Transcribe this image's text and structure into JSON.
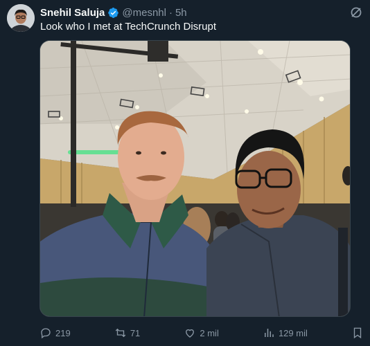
{
  "tweet": {
    "author_name": "Snehil Saluja",
    "handle": "@mesnhl",
    "separator": "·",
    "time": "5h",
    "text": "Look who I met at TechCrunch Disrupt",
    "verified": true,
    "accent_color": "#1d9bf0"
  },
  "actions": {
    "replies": "219",
    "reposts": "71",
    "likes": "2 mil",
    "views": "129 mil"
  },
  "icons": {
    "grok": "grok-icon",
    "reply": "reply-icon",
    "repost": "repost-icon",
    "like": "heart-icon",
    "views": "views-icon",
    "bookmark": "bookmark-icon"
  },
  "theme": {
    "background": "#15202b",
    "text_primary": "#f7f9f9",
    "text_secondary": "#8b98a5"
  }
}
